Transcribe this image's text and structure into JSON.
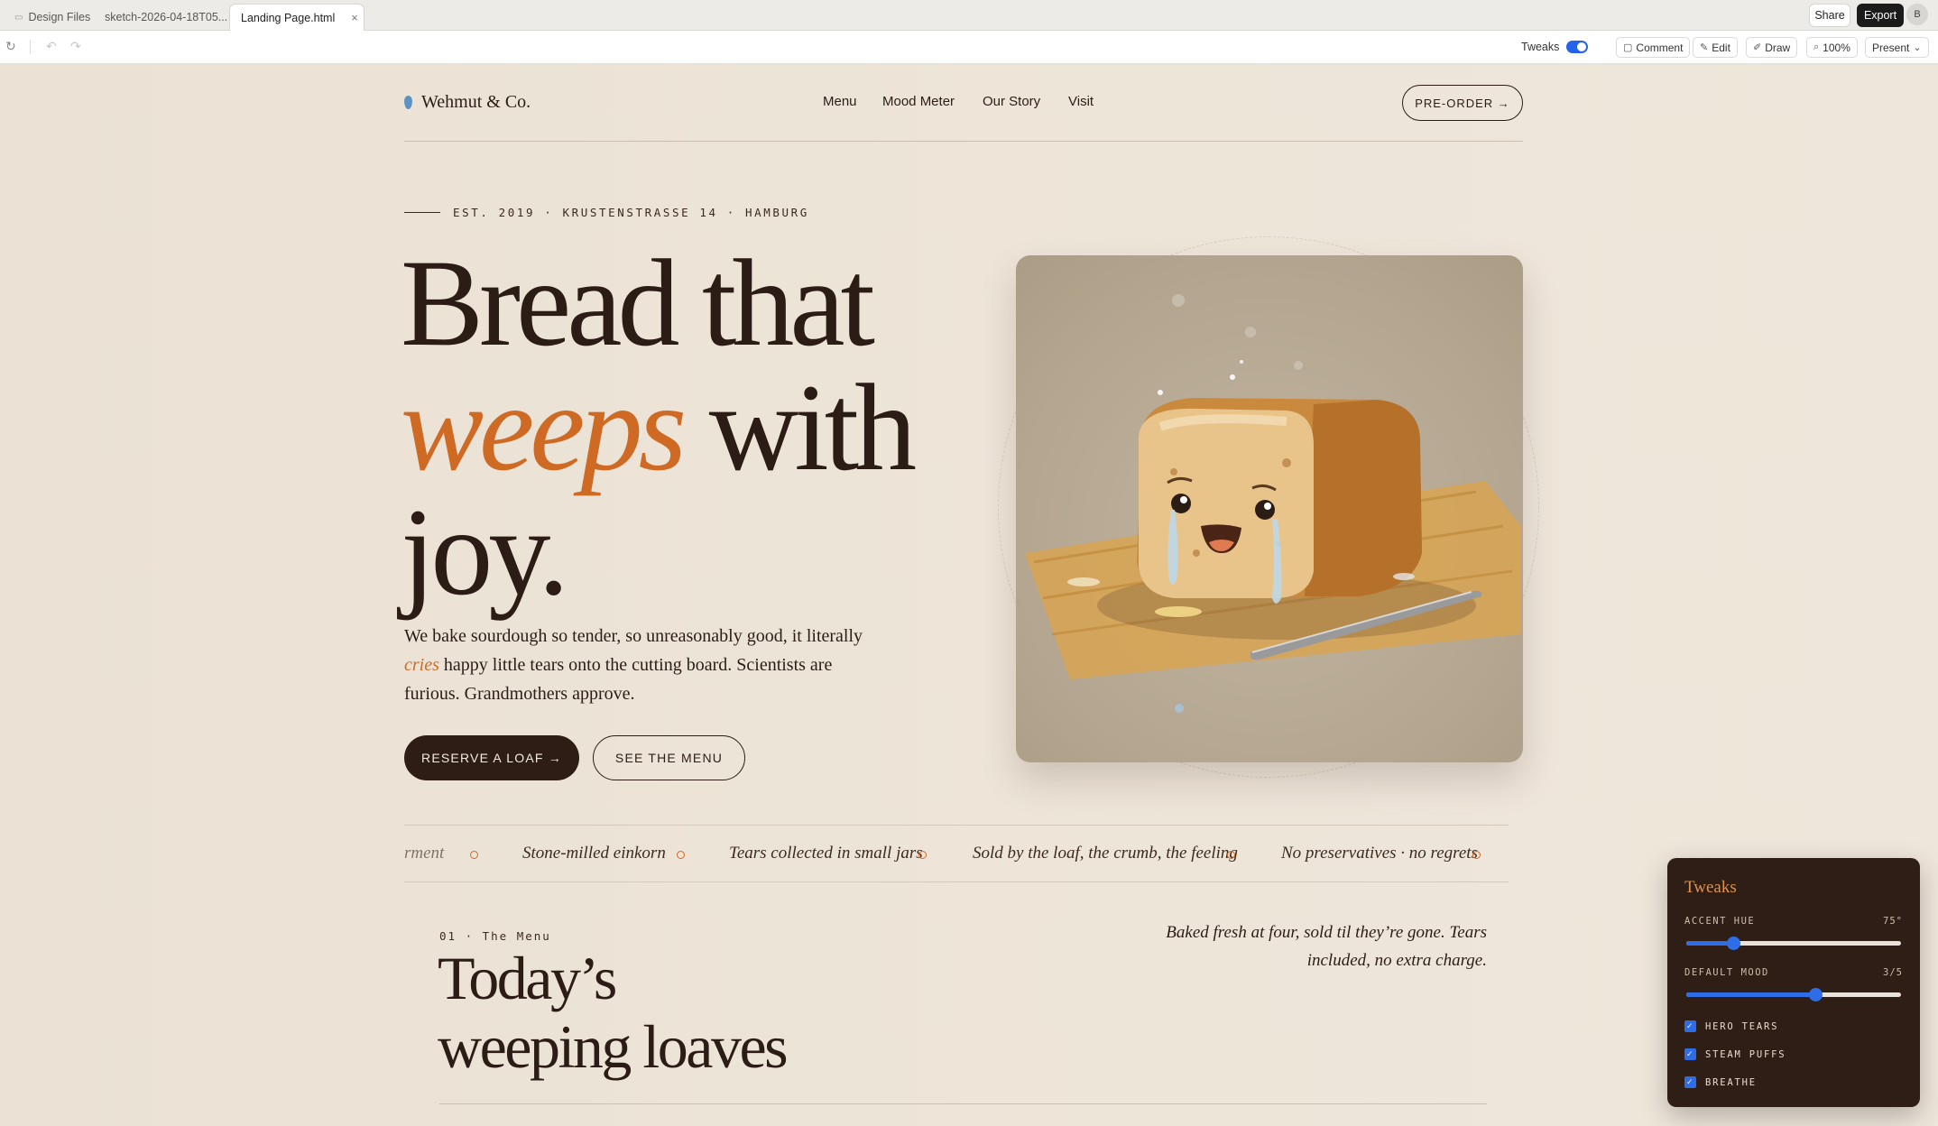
{
  "tabs": [
    {
      "label": "Design Files",
      "active": false
    },
    {
      "label": "sketch-2026-04-18T05...",
      "active": false
    },
    {
      "label": "Landing Page.html",
      "active": true
    }
  ],
  "topbar": {
    "share": "Share",
    "export": "Export",
    "avatar_initial": "B"
  },
  "toolbar": {
    "tweaks_label": "Tweaks",
    "tweaks_on": true,
    "comment": "Comment",
    "edit": "Edit",
    "draw": "Draw",
    "zoom": "100%",
    "present": "Present"
  },
  "site": {
    "brand": "Wehmut & Co.",
    "nav": [
      "Menu",
      "Mood Meter",
      "Our Story",
      "Visit"
    ],
    "preorder": "PRE-ORDER →",
    "eyebrow": "EST. 2019 · KRUSTENSTRASSE 14 · HAMBURG",
    "headline": {
      "l1": "Bread that",
      "accent": "weeps",
      "l2_rest": "with",
      "l3": "joy."
    },
    "lede": {
      "before": "We bake sourdough so tender, so unreasonably good, it literally",
      "accent": "cries",
      "after": "happy little tears onto the cutting board. Scientists are furious. Grandmothers approve."
    },
    "cta_primary": "RESERVE A LOAF →",
    "cta_secondary": "SEE THE MENU",
    "marquee": [
      "rment",
      "Stone-milled einkorn",
      "Tears collected in small jars",
      "Sold by the loaf, the crumb, the feeling",
      "No preservatives · no regrets"
    ],
    "section": {
      "eyebrow": "01 · The Menu",
      "title_l1": "Today’s",
      "title_l2": "weeping loaves",
      "note": "Baked fresh at four, sold til they’re gone. Tears included, no extra charge."
    }
  },
  "tweaks_panel": {
    "title": "Tweaks",
    "accent_hue_label": "ACCENT HUE",
    "accent_hue_value": "75°",
    "accent_hue_fraction": 0.22,
    "mood_label": "DEFAULT MOOD",
    "mood_value": "3/5",
    "mood_fraction": 0.6,
    "checks": [
      {
        "label": "HERO TEARS",
        "checked": true
      },
      {
        "label": "STEAM PUFFS",
        "checked": true
      },
      {
        "label": "BREATHE",
        "checked": true
      }
    ]
  },
  "colors": {
    "accent": "#cf6a24",
    "ink": "#2b1d15",
    "page_bg": "#ece2d6",
    "toggle_blue": "#2563eb"
  }
}
